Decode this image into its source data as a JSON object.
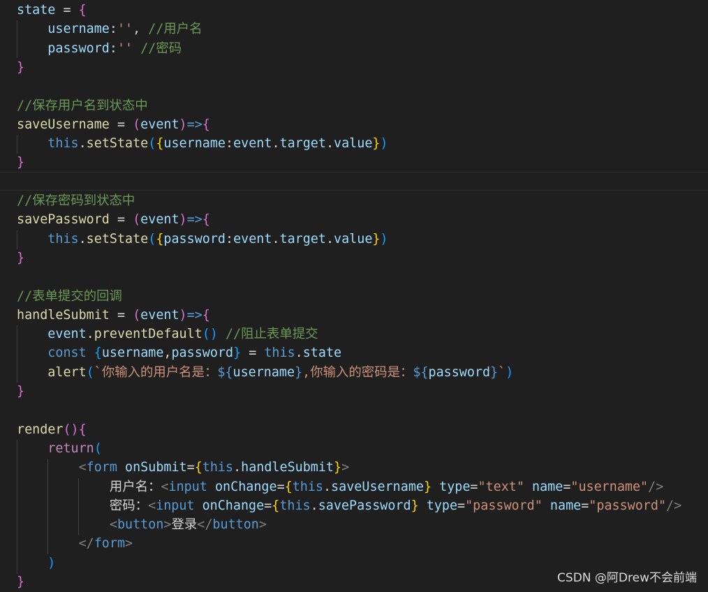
{
  "code_lines": [
    [
      {
        "t": "state",
        "c": "var"
      },
      {
        "t": " = ",
        "c": "op"
      },
      {
        "t": "{",
        "c": "b2"
      }
    ],
    [
      {
        "t": "    "
      },
      {
        "t": "username",
        "c": "var"
      },
      {
        "t": ":",
        "c": "punct"
      },
      {
        "t": "''",
        "c": "str"
      },
      {
        "t": ", ",
        "c": "punct"
      },
      {
        "t": "//用户名",
        "c": "cmt"
      }
    ],
    [
      {
        "t": "    "
      },
      {
        "t": "password",
        "c": "var"
      },
      {
        "t": ":",
        "c": "punct"
      },
      {
        "t": "''",
        "c": "str"
      },
      {
        "t": " ",
        "c": "plain"
      },
      {
        "t": "//密码",
        "c": "cmt"
      }
    ],
    [
      {
        "t": "}",
        "c": "b2"
      }
    ],
    [],
    [
      {
        "t": "//保存用户名到状态中",
        "c": "cmt"
      }
    ],
    [
      {
        "t": "saveUsername",
        "c": "fn"
      },
      {
        "t": " = ",
        "c": "op"
      },
      {
        "t": "(",
        "c": "b2"
      },
      {
        "t": "event",
        "c": "var"
      },
      {
        "t": ")",
        "c": "b2"
      },
      {
        "t": "=>",
        "c": "kw"
      },
      {
        "t": "{",
        "c": "b2"
      }
    ],
    [
      {
        "t": "    "
      },
      {
        "t": "this",
        "c": "kw"
      },
      {
        "t": ".",
        "c": "punct"
      },
      {
        "t": "setState",
        "c": "fn"
      },
      {
        "t": "(",
        "c": "b3"
      },
      {
        "t": "{",
        "c": "b1"
      },
      {
        "t": "username",
        "c": "var"
      },
      {
        "t": ":",
        "c": "punct"
      },
      {
        "t": "event",
        "c": "var"
      },
      {
        "t": ".",
        "c": "punct"
      },
      {
        "t": "target",
        "c": "var"
      },
      {
        "t": ".",
        "c": "punct"
      },
      {
        "t": "value",
        "c": "var"
      },
      {
        "t": "}",
        "c": "b1"
      },
      {
        "t": ")",
        "c": "b3"
      }
    ],
    [
      {
        "t": "}",
        "c": "b2"
      }
    ],
    [],
    [
      {
        "t": "//保存密码到状态中",
        "c": "cmt"
      }
    ],
    [
      {
        "t": "savePassword",
        "c": "fn"
      },
      {
        "t": " = ",
        "c": "op"
      },
      {
        "t": "(",
        "c": "b2"
      },
      {
        "t": "event",
        "c": "var"
      },
      {
        "t": ")",
        "c": "b2"
      },
      {
        "t": "=>",
        "c": "kw"
      },
      {
        "t": "{",
        "c": "b2"
      }
    ],
    [
      {
        "t": "    "
      },
      {
        "t": "this",
        "c": "kw"
      },
      {
        "t": ".",
        "c": "punct"
      },
      {
        "t": "setState",
        "c": "fn"
      },
      {
        "t": "(",
        "c": "b3"
      },
      {
        "t": "{",
        "c": "b1"
      },
      {
        "t": "password",
        "c": "var"
      },
      {
        "t": ":",
        "c": "punct"
      },
      {
        "t": "event",
        "c": "var"
      },
      {
        "t": ".",
        "c": "punct"
      },
      {
        "t": "target",
        "c": "var"
      },
      {
        "t": ".",
        "c": "punct"
      },
      {
        "t": "value",
        "c": "var"
      },
      {
        "t": "}",
        "c": "b1"
      },
      {
        "t": ")",
        "c": "b3"
      }
    ],
    [
      {
        "t": "}",
        "c": "b2"
      }
    ],
    [],
    [
      {
        "t": "//表单提交的回调",
        "c": "cmt"
      }
    ],
    [
      {
        "t": "handleSubmit",
        "c": "fn"
      },
      {
        "t": " = ",
        "c": "op"
      },
      {
        "t": "(",
        "c": "b2"
      },
      {
        "t": "event",
        "c": "var"
      },
      {
        "t": ")",
        "c": "b2"
      },
      {
        "t": "=>",
        "c": "kw"
      },
      {
        "t": "{",
        "c": "b2"
      }
    ],
    [
      {
        "t": "    "
      },
      {
        "t": "event",
        "c": "var"
      },
      {
        "t": ".",
        "c": "punct"
      },
      {
        "t": "preventDefault",
        "c": "fn"
      },
      {
        "t": "()",
        "c": "b3"
      },
      {
        "t": " ",
        "c": "plain"
      },
      {
        "t": "//阻止表单提交",
        "c": "cmt"
      }
    ],
    [
      {
        "t": "    "
      },
      {
        "t": "const",
        "c": "kw"
      },
      {
        "t": " ",
        "c": "plain"
      },
      {
        "t": "{",
        "c": "b3"
      },
      {
        "t": "username",
        "c": "var"
      },
      {
        "t": ",",
        "c": "punct"
      },
      {
        "t": "password",
        "c": "var"
      },
      {
        "t": "}",
        "c": "b3"
      },
      {
        "t": " = ",
        "c": "op"
      },
      {
        "t": "this",
        "c": "kw"
      },
      {
        "t": ".",
        "c": "punct"
      },
      {
        "t": "state",
        "c": "var"
      }
    ],
    [
      {
        "t": "    "
      },
      {
        "t": "alert",
        "c": "fn"
      },
      {
        "t": "(",
        "c": "b3"
      },
      {
        "t": "`你输入的用户名是：",
        "c": "str"
      },
      {
        "t": "${",
        "c": "tpl"
      },
      {
        "t": "username",
        "c": "var"
      },
      {
        "t": "}",
        "c": "tpl"
      },
      {
        "t": ",你输入的密码是：",
        "c": "str"
      },
      {
        "t": "${",
        "c": "tpl"
      },
      {
        "t": "password",
        "c": "var"
      },
      {
        "t": "}",
        "c": "tpl"
      },
      {
        "t": "`",
        "c": "str"
      },
      {
        "t": ")",
        "c": "b3"
      }
    ],
    [
      {
        "t": "}",
        "c": "b2"
      }
    ],
    [],
    [
      {
        "t": "render",
        "c": "fn"
      },
      {
        "t": "()",
        "c": "b2"
      },
      {
        "t": "{",
        "c": "b2"
      }
    ],
    [
      {
        "t": "    "
      },
      {
        "t": "return",
        "c": "ctrl"
      },
      {
        "t": "(",
        "c": "b3"
      }
    ],
    [
      {
        "t": "        "
      },
      {
        "t": "<",
        "c": "tagbr"
      },
      {
        "t": "form",
        "c": "tag"
      },
      {
        "t": " ",
        "c": "plain"
      },
      {
        "t": "onSubmit",
        "c": "var"
      },
      {
        "t": "=",
        "c": "op"
      },
      {
        "t": "{",
        "c": "b1"
      },
      {
        "t": "this",
        "c": "kw"
      },
      {
        "t": ".",
        "c": "punct"
      },
      {
        "t": "handleSubmit",
        "c": "var"
      },
      {
        "t": "}",
        "c": "b1"
      },
      {
        "t": ">",
        "c": "tagbr"
      }
    ],
    [
      {
        "t": "            "
      },
      {
        "t": "用户名：",
        "c": "text"
      },
      {
        "t": "<",
        "c": "tagbr"
      },
      {
        "t": "input",
        "c": "tag"
      },
      {
        "t": " ",
        "c": "plain"
      },
      {
        "t": "onChange",
        "c": "var"
      },
      {
        "t": "=",
        "c": "op"
      },
      {
        "t": "{",
        "c": "b1"
      },
      {
        "t": "this",
        "c": "kw"
      },
      {
        "t": ".",
        "c": "punct"
      },
      {
        "t": "saveUsername",
        "c": "var"
      },
      {
        "t": "}",
        "c": "b1"
      },
      {
        "t": " ",
        "c": "plain"
      },
      {
        "t": "type",
        "c": "var"
      },
      {
        "t": "=",
        "c": "op"
      },
      {
        "t": "\"text\"",
        "c": "str"
      },
      {
        "t": " ",
        "c": "plain"
      },
      {
        "t": "name",
        "c": "var"
      },
      {
        "t": "=",
        "c": "op"
      },
      {
        "t": "\"username\"",
        "c": "str"
      },
      {
        "t": "/>",
        "c": "tagbr"
      }
    ],
    [
      {
        "t": "            "
      },
      {
        "t": "密码：",
        "c": "text"
      },
      {
        "t": "<",
        "c": "tagbr"
      },
      {
        "t": "input",
        "c": "tag"
      },
      {
        "t": " ",
        "c": "plain"
      },
      {
        "t": "onChange",
        "c": "var"
      },
      {
        "t": "=",
        "c": "op"
      },
      {
        "t": "{",
        "c": "b1"
      },
      {
        "t": "this",
        "c": "kw"
      },
      {
        "t": ".",
        "c": "punct"
      },
      {
        "t": "savePassword",
        "c": "var"
      },
      {
        "t": "}",
        "c": "b1"
      },
      {
        "t": " ",
        "c": "plain"
      },
      {
        "t": "type",
        "c": "var"
      },
      {
        "t": "=",
        "c": "op"
      },
      {
        "t": "\"password\"",
        "c": "str"
      },
      {
        "t": " ",
        "c": "plain"
      },
      {
        "t": "name",
        "c": "var"
      },
      {
        "t": "=",
        "c": "op"
      },
      {
        "t": "\"password\"",
        "c": "str"
      },
      {
        "t": "/>",
        "c": "tagbr"
      }
    ],
    [
      {
        "t": "            "
      },
      {
        "t": "<",
        "c": "tagbr"
      },
      {
        "t": "button",
        "c": "tag"
      },
      {
        "t": ">",
        "c": "tagbr"
      },
      {
        "t": "登录",
        "c": "text"
      },
      {
        "t": "</",
        "c": "tagbr"
      },
      {
        "t": "button",
        "c": "tag"
      },
      {
        "t": ">",
        "c": "tagbr"
      }
    ],
    [
      {
        "t": "        "
      },
      {
        "t": "</",
        "c": "tagbr"
      },
      {
        "t": "form",
        "c": "tag"
      },
      {
        "t": ">",
        "c": "tagbr"
      }
    ],
    [
      {
        "t": "    "
      },
      {
        "t": ")",
        "c": "b3"
      }
    ],
    [
      {
        "t": "}",
        "c": "b2"
      }
    ]
  ],
  "watermark": "CSDN @阿Drew不会前端",
  "colors": {
    "background": "#1f1f1f",
    "variable": "#9cdcfe",
    "function": "#dcdcaa",
    "keyword": "#569cd6",
    "control": "#c586c0",
    "string": "#ce9178",
    "comment": "#6a9955",
    "bracket_gold": "#ffd700",
    "bracket_purple": "#da70d6",
    "bracket_blue": "#179fff"
  }
}
